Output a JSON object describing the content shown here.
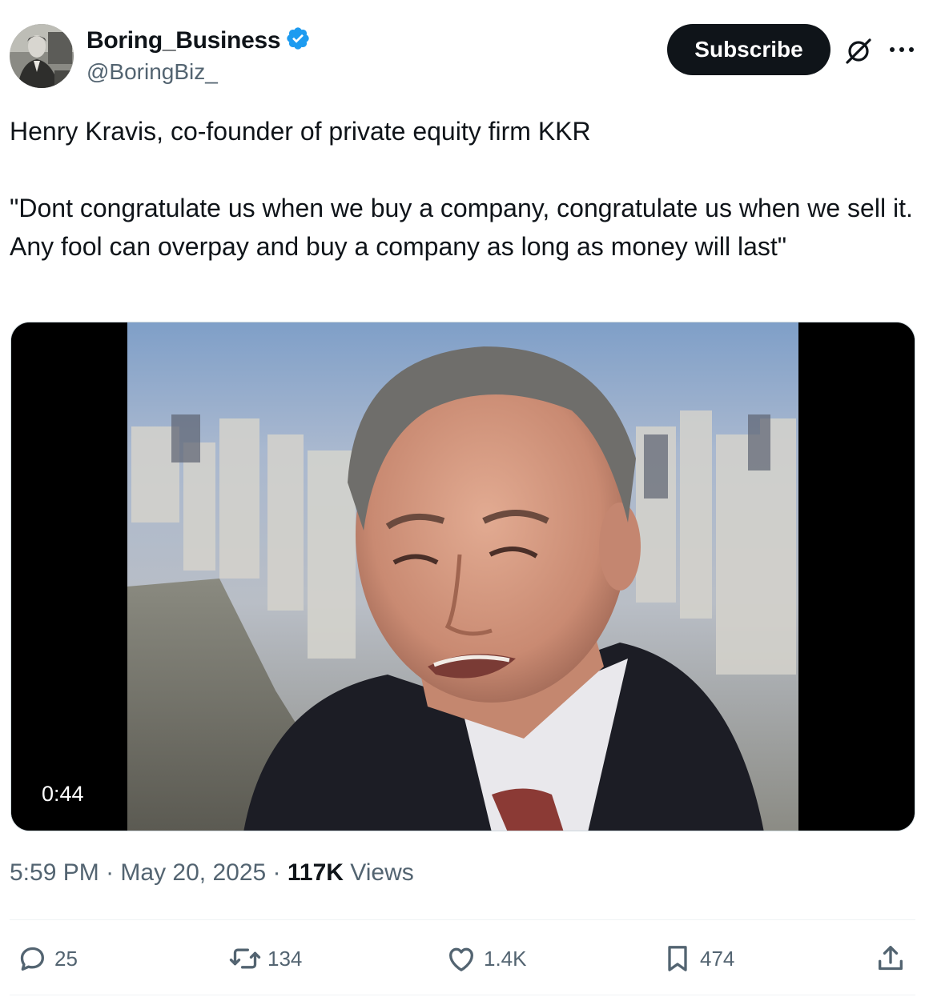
{
  "author": {
    "display_name": "Boring_Business",
    "handle": "@BoringBiz_",
    "verified_icon": "verified-badge-icon",
    "avatar": "avatar-photo"
  },
  "header": {
    "subscribe_label": "Subscribe",
    "grok_icon": "grok-icon",
    "more_icon": "more-icon"
  },
  "tweet": {
    "text": "Henry Kravis, co-founder of private equity firm KKR\n\n\"Dont congratulate us when we buy a company, congratulate us when we sell it. Any fool can overpay and buy a company as long as money will last\""
  },
  "video": {
    "duration": "0:44"
  },
  "meta": {
    "time": "5:59 PM",
    "separator": " · ",
    "date": "May 20, 2025",
    "views_count": "117K",
    "views_label": " Views"
  },
  "actions": {
    "replies": "25",
    "reposts": "134",
    "likes": "1.4K",
    "bookmarks": "474"
  },
  "colors": {
    "text": "#0f1419",
    "secondary": "#536471",
    "verified": "#1d9bf0",
    "button_bg": "#0f1419"
  }
}
